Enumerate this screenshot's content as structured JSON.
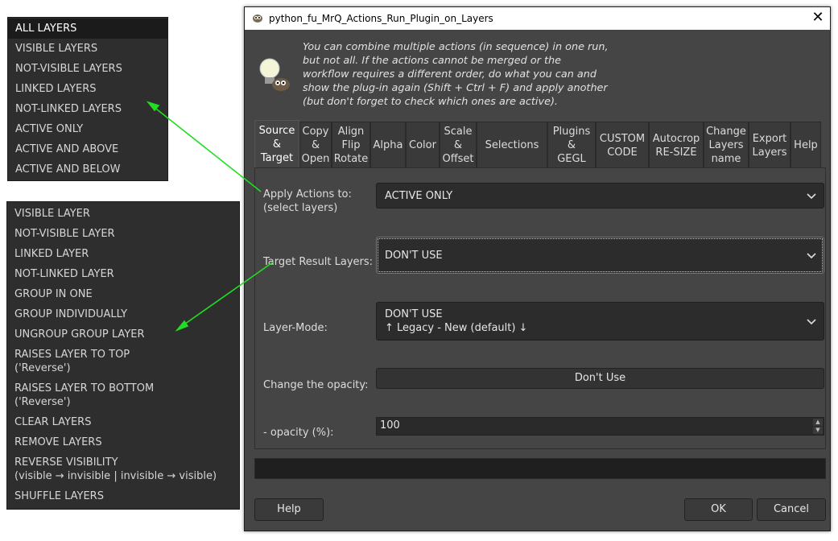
{
  "menu_top": {
    "items": [
      "ALL LAYERS",
      "VISIBLE LAYERS",
      "NOT-VISIBLE LAYERS",
      "LINKED LAYERS",
      "NOT-LINKED LAYERS",
      "ACTIVE ONLY",
      "ACTIVE AND ABOVE",
      "ACTIVE AND BELOW"
    ],
    "selected": "ALL LAYERS"
  },
  "menu_bottom": {
    "items": [
      "VISIBLE LAYER",
      "NOT-VISIBLE LAYER",
      "LINKED LAYER",
      "NOT-LINKED LAYER",
      "GROUP IN ONE",
      "GROUP INDIVIDUALLY",
      "UNGROUP GROUP LAYER",
      "RAISES LAYER TO TOP\n('Reverse')",
      "RAISES LAYER TO BOTTOM\n('Reverse')",
      "CLEAR LAYERS",
      "REMOVE LAYERS",
      "REVERSE VISIBILITY\n(visible → invisible | invisible → visible)",
      "SHUFFLE LAYERS"
    ]
  },
  "dialog": {
    "title": "python_fu_MrQ_Actions_Run_Plugin_on_Layers",
    "close_glyph": "✕",
    "info_text": "You can combine multiple actions (in sequence) in one run,\nbut not all. If the actions cannot be merged or the\nworkflow requires a different order, do what you can and\nshow the plug-in again (Shift + Ctrl + F) and apply another\n(but don't forget to check which ones are active).",
    "tabs": [
      {
        "label": "Source\n&\nTarget",
        "active": true
      },
      {
        "label": "Copy\n&\nOpen"
      },
      {
        "label": "Align\nFlip\nRotate"
      },
      {
        "label": "Alpha"
      },
      {
        "label": "Color"
      },
      {
        "label": "Scale\n&\nOffset"
      },
      {
        "label": "Selections"
      },
      {
        "label": "Plugins\n&\nGEGL"
      },
      {
        "label": "CUSTOM\nCODE"
      },
      {
        "label": "Autocrop\nRE-SIZE"
      },
      {
        "label": "Change\nLayers\nname"
      },
      {
        "label": "Export\nLayers"
      },
      {
        "label": "Help"
      }
    ],
    "fields": {
      "apply_label": "Apply Actions to:\n(select layers)",
      "apply_value": "ACTIVE ONLY",
      "target_label": "Target Result Layers:",
      "target_value": "DON'T USE",
      "mode_label": "Layer-Mode:",
      "mode_value": "DON'T USE\n↑ Legacy  -  New (default) ↓",
      "opacity_change_label": "Change the opacity:",
      "opacity_change_button": "Don't Use",
      "opacity_label": " - opacity (%):",
      "opacity_value": "100"
    },
    "buttons": {
      "help": "Help",
      "ok": "OK",
      "cancel": "Cancel"
    }
  },
  "colors": {
    "arrow": "#22dd22",
    "dialog_bg": "#454545",
    "menu_bg": "#2e2e2e"
  },
  "icons": [
    "gimp-wilber-icon",
    "lightbulb-info-icon",
    "chevron-down-icon",
    "close-icon"
  ]
}
